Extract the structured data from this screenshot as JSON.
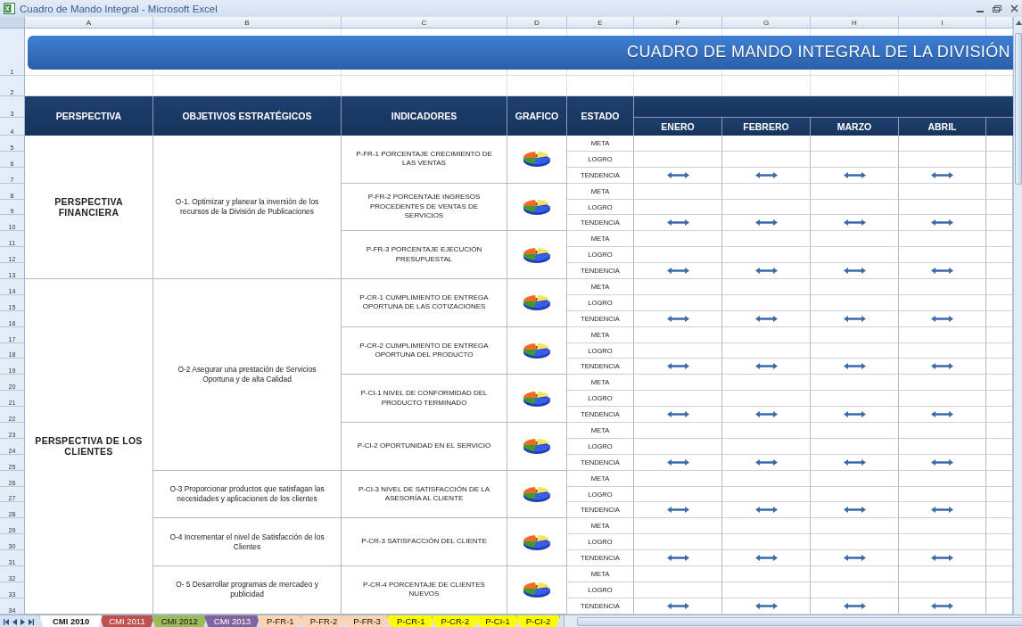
{
  "window": {
    "title": "Cuadro de Mando Integral - Microsoft Excel"
  },
  "column_headers": [
    "A",
    "B",
    "C",
    "D",
    "E",
    "F",
    "G",
    "H",
    "I"
  ],
  "row_numbers": [
    "1",
    "2",
    "3",
    "4",
    "5",
    "6",
    "7",
    "8",
    "9",
    "10",
    "11",
    "12",
    "13",
    "14",
    "15",
    "16",
    "17",
    "18",
    "19",
    "20",
    "21",
    "22",
    "23",
    "24",
    "25",
    "26",
    "27",
    "28",
    "29",
    "30",
    "31",
    "32",
    "33",
    "34"
  ],
  "banner": {
    "title": "CUADRO DE MANDO INTEGRAL DE LA DIVISIÓN"
  },
  "header": {
    "columns": [
      "PERSPECTIVA",
      "OBJETIVOS ESTRATÉGICOS",
      "INDICADORES",
      "GRAFICO",
      "ESTADO"
    ],
    "months": [
      "ENERO",
      "FEBRERO",
      "MARZO",
      "ABRIL"
    ]
  },
  "perspectives": [
    {
      "name": "PERSPECTIVA FINANCIERA",
      "objectives": [
        {
          "text": "O-1. Optimizar y planear la inversión de los recursos de la División de Publicaciones",
          "indicators": [
            {
              "text": "P-FR-1  PORCENTAJE CRECIMIENTO DE LAS VENTAS",
              "estado": [
                {
                  "label": "META",
                  "kind": "value"
                },
                {
                  "label": "LOGRO",
                  "kind": "value"
                },
                {
                  "label": "TENDENCIA",
                  "kind": "trend"
                }
              ]
            },
            {
              "text": "P-FR-2  PORCENTAJE INGRESOS PROCEDENTES DE VENTAS DE SERVICIOS",
              "estado": [
                {
                  "label": "META",
                  "kind": "value"
                },
                {
                  "label": "LOGRO",
                  "kind": "value"
                },
                {
                  "label": "TENDENCIA",
                  "kind": "trend"
                }
              ]
            },
            {
              "text": "P-FR-3  PORCENTAJE EJECUCIÓN PRESUPUESTAL",
              "estado": [
                {
                  "label": "META",
                  "kind": "value"
                },
                {
                  "label": "LOGRO",
                  "kind": "value"
                },
                {
                  "label": "TENDENCIA",
                  "kind": "trend"
                }
              ]
            }
          ]
        }
      ]
    },
    {
      "name": "PERSPECTIVA DE LOS CLIENTES",
      "objectives": [
        {
          "text": "O-2  Asegurar una prestación de Servicios Oportuna y de alta Calidad",
          "indicators": [
            {
              "text": "P-CR-1  CUMPLIMIENTO DE ENTREGA OPORTUNA DE LAS COTIZACIONES",
              "estado": [
                {
                  "label": "META",
                  "kind": "value"
                },
                {
                  "label": "LOGRO",
                  "kind": "value"
                },
                {
                  "label": "TENDENCIA",
                  "kind": "trend"
                }
              ]
            },
            {
              "text": "P-CR-2  CUMPLIMIENTO DE ENTREGA OPORTUNA DEL PRODUCTO",
              "estado": [
                {
                  "label": "META",
                  "kind": "value"
                },
                {
                  "label": "LOGRO",
                  "kind": "value"
                },
                {
                  "label": "TENDENCIA",
                  "kind": "trend"
                }
              ]
            },
            {
              "text": "P-CI-1  NIVEL DE CONFORMIDAD DEL PRODUCTO TERMINADO",
              "estado": [
                {
                  "label": "META",
                  "kind": "value"
                },
                {
                  "label": "LOGRO",
                  "kind": "value"
                },
                {
                  "label": "TENDENCIA",
                  "kind": "trend"
                }
              ]
            },
            {
              "text": "P-CI-2  OPORTUNIDAD EN EL SERVICIO",
              "estado": [
                {
                  "label": "META",
                  "kind": "value"
                },
                {
                  "label": "LOGRO",
                  "kind": "value"
                },
                {
                  "label": "TENDENCIA",
                  "kind": "trend"
                }
              ]
            }
          ]
        },
        {
          "text": "O-3  Proporcionar productos que satisfagan las necesidades y aplicaciones de los clientes",
          "indicators": [
            {
              "text": "P-CI-3  NIVEL DE SATISFACCIÓN DE LA ASESORÍA AL CLIENTE",
              "estado": [
                {
                  "label": "META",
                  "kind": "value"
                },
                {
                  "label": "LOGRO",
                  "kind": "value"
                },
                {
                  "label": "TENDENCIA",
                  "kind": "trend"
                }
              ]
            }
          ]
        },
        {
          "text": "O-4  Incrementar el nivel de Satisfacción de los Clientes",
          "indicators": [
            {
              "text": "P-CR-3  SATISFACCIÓN DEL CLIENTE",
              "estado": [
                {
                  "label": "META",
                  "kind": "value"
                },
                {
                  "label": "LOGRO",
                  "kind": "value"
                },
                {
                  "label": "TENDENCIA",
                  "kind": "trend"
                }
              ]
            }
          ]
        },
        {
          "text": "O- 5 Desarrollar programas de mercadeo y publicidad",
          "indicators": [
            {
              "text": "P-CR-4  PORCENTAJE DE CLIENTES NUEVOS",
              "estado": [
                {
                  "label": "META",
                  "kind": "value"
                },
                {
                  "label": "LOGRO",
                  "kind": "value"
                },
                {
                  "label": "TENDENCIA",
                  "kind": "trend"
                }
              ]
            }
          ]
        }
      ]
    }
  ],
  "sheet_tabs": [
    {
      "label": "CMI 2010",
      "selected": true,
      "color": "#ffffff"
    },
    {
      "label": "CMI 2011",
      "selected": false,
      "color": "#c0504d"
    },
    {
      "label": "CMI 2012",
      "selected": false,
      "color": "#9bbb59"
    },
    {
      "label": "CMI 2013",
      "selected": false,
      "color": "#8064a2"
    },
    {
      "label": "P-FR-1",
      "selected": false,
      "color": "#fbd4b4"
    },
    {
      "label": "P-FR-2",
      "selected": false,
      "color": "#fbd4b4"
    },
    {
      "label": "P-FR-3",
      "selected": false,
      "color": "#fbd4b4"
    },
    {
      "label": "P-CR-1",
      "selected": false,
      "color": "#ffff00"
    },
    {
      "label": "P-CR-2",
      "selected": false,
      "color": "#ffff00"
    },
    {
      "label": "P-CI-1",
      "selected": false,
      "color": "#ffff00"
    },
    {
      "label": "P-CI-2",
      "selected": false,
      "color": "#ffff00"
    }
  ]
}
